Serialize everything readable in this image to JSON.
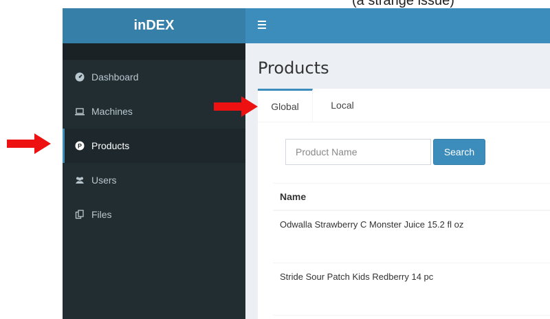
{
  "top_text": "(a strange issue)",
  "app": {
    "title": "inDEX"
  },
  "sidebar": {
    "items": [
      {
        "label": "Dashboard",
        "icon": "dashboard-icon",
        "active": false
      },
      {
        "label": "Machines",
        "icon": "laptop-icon",
        "active": false
      },
      {
        "label": "Products",
        "icon": "product-p-icon",
        "active": true
      },
      {
        "label": "Users",
        "icon": "users-icon",
        "active": false
      },
      {
        "label": "Files",
        "icon": "files-icon",
        "active": false
      }
    ]
  },
  "main": {
    "title": "Products",
    "tabs": [
      {
        "label": "Global",
        "active": true
      },
      {
        "label": "Local",
        "active": false
      }
    ],
    "search": {
      "placeholder": "Product Name",
      "button_label": "Search"
    },
    "table": {
      "header": "Name",
      "rows": [
        "Odwalla Strawberry C Monster Juice 15.2 fl oz",
        "Stride Sour Patch Kids Redberry 14 pc"
      ]
    }
  },
  "colors": {
    "header": "#3c8dbc",
    "logo": "#367fa9",
    "sidebar": "#222d32",
    "arrow": "#ee1111"
  }
}
